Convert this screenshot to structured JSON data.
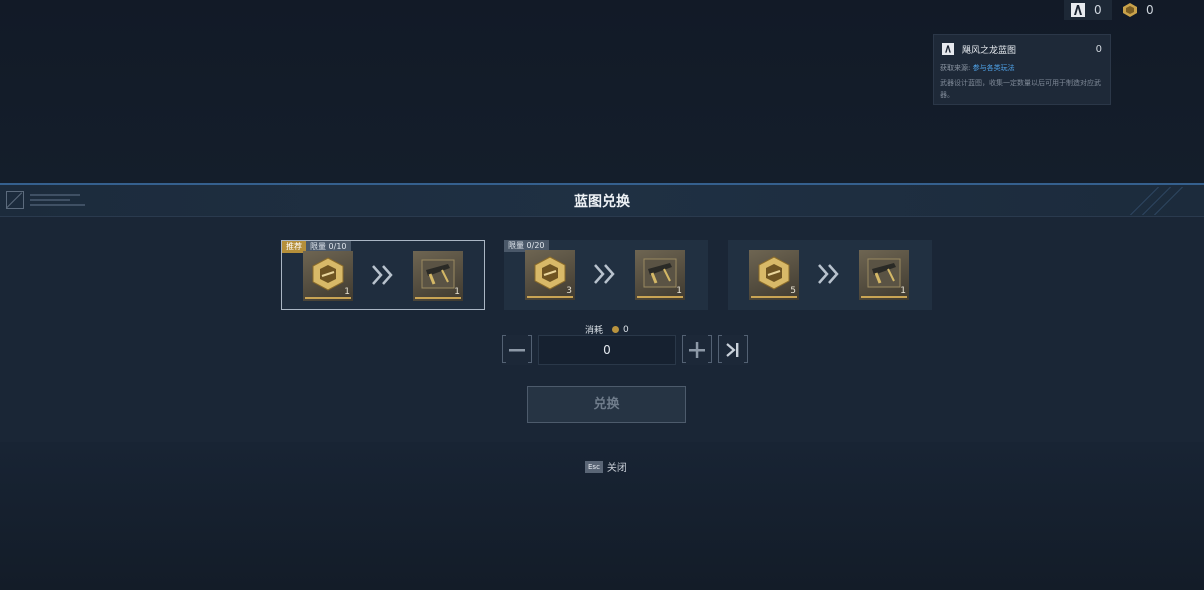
{
  "currencies": [
    {
      "icon": "blueprint-token-icon",
      "value": "0"
    },
    {
      "icon": "gold-material-icon",
      "value": "0"
    }
  ],
  "tooltip": {
    "icon": "blueprint-token-icon",
    "title": "飓风之龙蓝图",
    "count": "0",
    "source_label": "获取来源:",
    "source_link": "参与各类玩法",
    "description": "武器设计蓝图，收集一定数量以后可用于制造对应武器。"
  },
  "panel": {
    "title": "蓝图兑换"
  },
  "cards": [
    {
      "recommended": "推荐",
      "limit": "限量 0/10",
      "input_qty": "1",
      "output_qty": "1",
      "selected": true
    },
    {
      "recommended": "",
      "limit": "限量 0/20",
      "input_qty": "3",
      "output_qty": "1",
      "selected": false
    },
    {
      "recommended": "",
      "limit": "",
      "input_qty": "5",
      "output_qty": "1",
      "selected": false
    }
  ],
  "consume": {
    "label": "消耗",
    "value": "0"
  },
  "quantity": {
    "value": "0"
  },
  "exchange_button": {
    "label": "兑换"
  },
  "footer": {
    "key": "Esc",
    "label": "关闭"
  },
  "colors": {
    "accent_gold": "#c9a454",
    "panel_border": "#35608e",
    "link": "#4fa2e8"
  }
}
